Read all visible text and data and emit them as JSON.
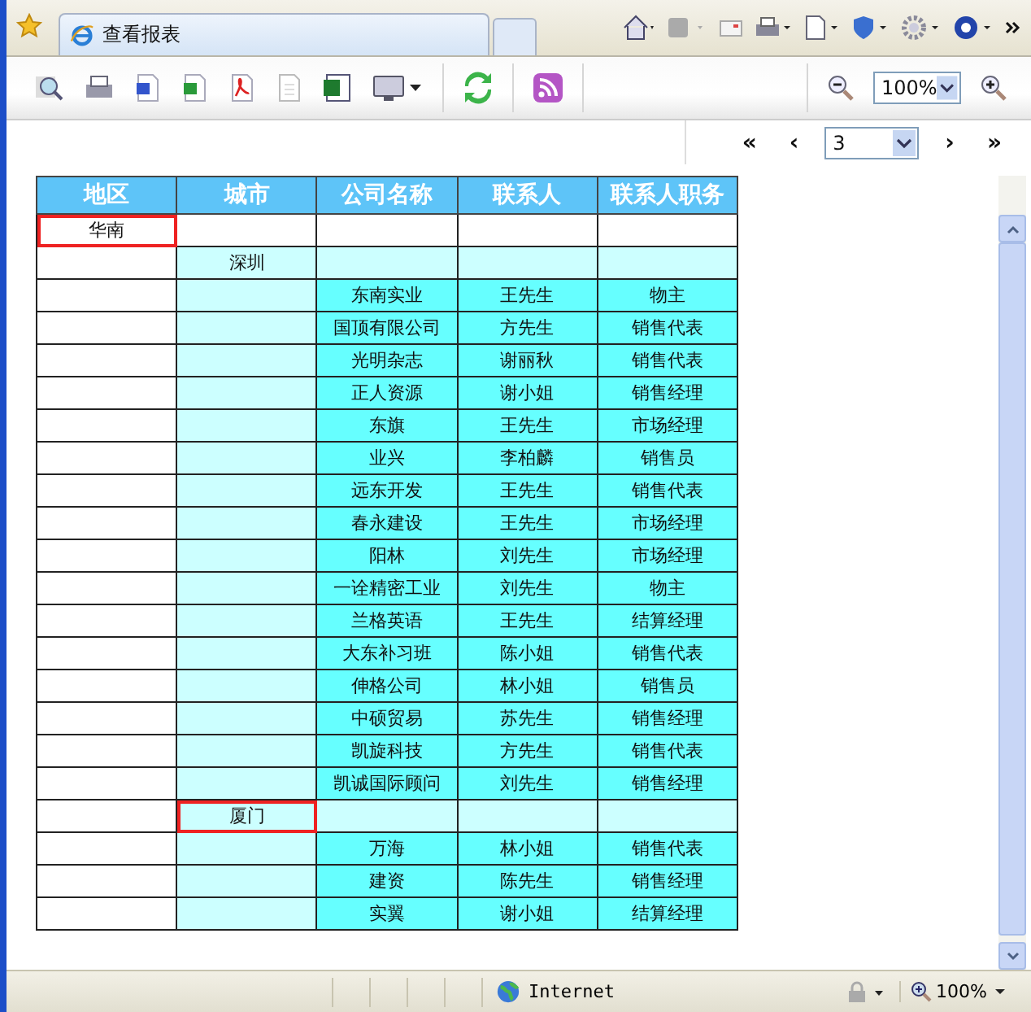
{
  "browser_tab": {
    "title": "查看报表"
  },
  "zoom_select": {
    "value": "100%"
  },
  "pager": {
    "first": "«",
    "prev": "‹",
    "page": "3",
    "next": "›",
    "last": "»"
  },
  "table": {
    "columns": [
      "地区",
      "城市",
      "公司名称",
      "联系人",
      "联系人职务"
    ],
    "rows": [
      {
        "kind": "region",
        "outlined": true,
        "cells": [
          "华南",
          "",
          "",
          "",
          ""
        ]
      },
      {
        "kind": "city",
        "outlined": false,
        "cells": [
          "",
          "深圳",
          "",
          "",
          ""
        ]
      },
      {
        "kind": "data",
        "cells": [
          "",
          "",
          "东南实业",
          "王先生",
          "物主"
        ]
      },
      {
        "kind": "data",
        "cells": [
          "",
          "",
          "国顶有限公司",
          "方先生",
          "销售代表"
        ]
      },
      {
        "kind": "data",
        "cells": [
          "",
          "",
          "光明杂志",
          "谢丽秋",
          "销售代表"
        ]
      },
      {
        "kind": "data",
        "cells": [
          "",
          "",
          "正人资源",
          "谢小姐",
          "销售经理"
        ]
      },
      {
        "kind": "data",
        "cells": [
          "",
          "",
          "东旗",
          "王先生",
          "市场经理"
        ]
      },
      {
        "kind": "data",
        "cells": [
          "",
          "",
          "业兴",
          "李柏麟",
          "销售员"
        ]
      },
      {
        "kind": "data",
        "cells": [
          "",
          "",
          "远东开发",
          "王先生",
          "销售代表"
        ]
      },
      {
        "kind": "data",
        "cells": [
          "",
          "",
          "春永建设",
          "王先生",
          "市场经理"
        ]
      },
      {
        "kind": "data",
        "cells": [
          "",
          "",
          "阳林",
          "刘先生",
          "市场经理"
        ]
      },
      {
        "kind": "data",
        "cells": [
          "",
          "",
          "一诠精密工业",
          "刘先生",
          "物主"
        ]
      },
      {
        "kind": "data",
        "cells": [
          "",
          "",
          "兰格英语",
          "王先生",
          "结算经理"
        ]
      },
      {
        "kind": "data",
        "cells": [
          "",
          "",
          "大东补习班",
          "陈小姐",
          "销售代表"
        ]
      },
      {
        "kind": "data",
        "cells": [
          "",
          "",
          "伸格公司",
          "林小姐",
          "销售员"
        ]
      },
      {
        "kind": "data",
        "cells": [
          "",
          "",
          "中硕贸易",
          "苏先生",
          "销售经理"
        ]
      },
      {
        "kind": "data",
        "cells": [
          "",
          "",
          "凯旋科技",
          "方先生",
          "销售代表"
        ]
      },
      {
        "kind": "data",
        "cells": [
          "",
          "",
          "凯诚国际顾问",
          "刘先生",
          "销售经理"
        ]
      },
      {
        "kind": "city",
        "outlined": true,
        "cells": [
          "",
          "厦门",
          "",
          "",
          ""
        ]
      },
      {
        "kind": "data",
        "cells": [
          "",
          "",
          "万海",
          "林小姐",
          "销售代表"
        ]
      },
      {
        "kind": "data",
        "cells": [
          "",
          "",
          "建资",
          "陈先生",
          "销售经理"
        ]
      },
      {
        "kind": "data",
        "cells": [
          "",
          "",
          "实翼",
          "谢小姐",
          "结算经理"
        ]
      }
    ]
  },
  "status_bar": {
    "zone": "Internet",
    "zoom": "100%"
  }
}
